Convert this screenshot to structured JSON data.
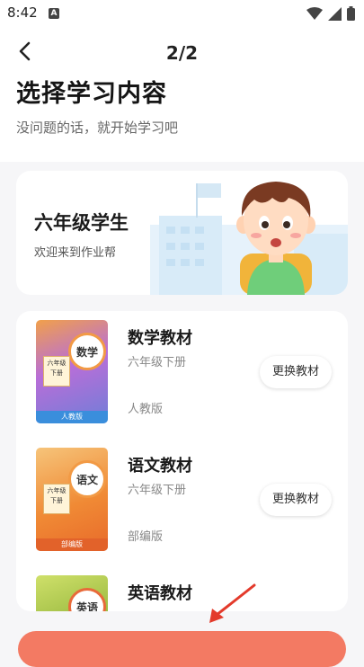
{
  "status_bar": {
    "time": "8:42",
    "notification_letter": "A",
    "icons": [
      "wifi-icon",
      "signal-icon",
      "battery-icon"
    ]
  },
  "header": {
    "page_indicator": "2/2",
    "title": "选择学习内容",
    "subtitle": "没问题的话，就开始学习吧"
  },
  "grade_card": {
    "grade": "六年级学生",
    "welcome": "欢迎来到作业帮"
  },
  "books": [
    {
      "name": "数学教材",
      "grade": "六年级下册",
      "edition": "人教版",
      "button": "更换教材",
      "cover": {
        "subject": "数学",
        "grade_line1": "六年级",
        "grade_line2": "下册",
        "publisher": "人教版",
        "color": "#6f7ed8"
      }
    },
    {
      "name": "语文教材",
      "grade": "六年级下册",
      "edition": "部编版",
      "button": "更换教材",
      "cover": {
        "subject": "语文",
        "grade_line1": "六年级",
        "grade_line2": "下册",
        "publisher": "部编版",
        "color": "#f08a35"
      }
    },
    {
      "name": "英语教材",
      "grade": "",
      "edition": "",
      "button": "",
      "cover": {
        "subject": "英语",
        "grade_line1": "",
        "grade_line2": "",
        "publisher": "",
        "color": "#8fb238"
      }
    }
  ],
  "colors": {
    "accent": "#f37a63",
    "arrow": "#e33a2b"
  }
}
